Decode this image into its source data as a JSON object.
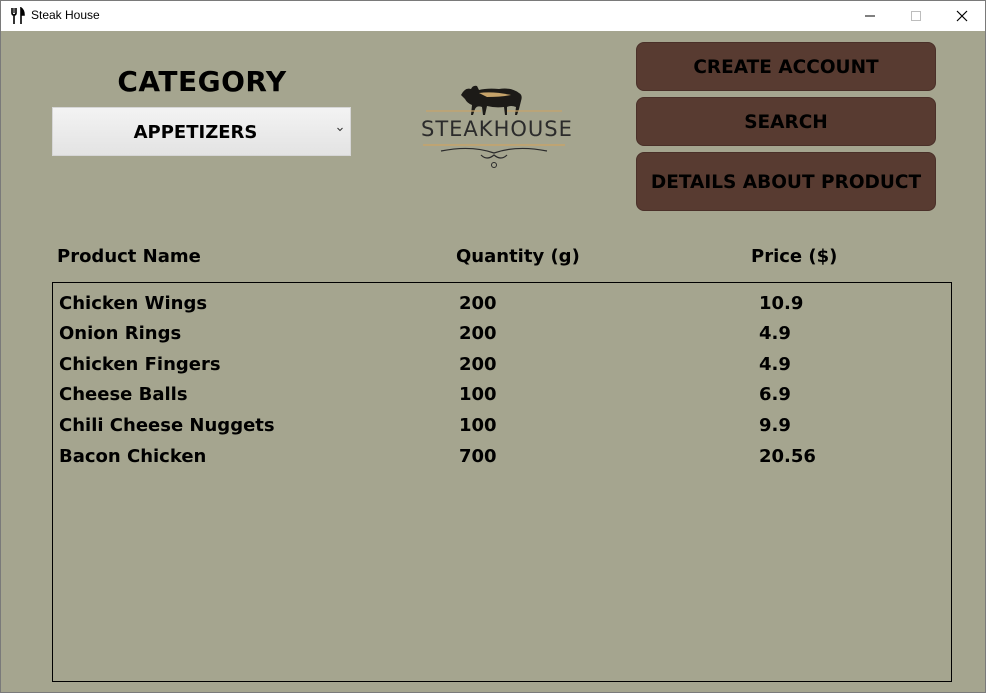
{
  "window": {
    "title": "Steak House",
    "app_icon": "fork-knife-icon"
  },
  "category": {
    "label": "CATEGORY",
    "selected": "APPETIZERS"
  },
  "logo": {
    "text": "STEAKHOUSE"
  },
  "buttons": {
    "create_account": "CREATE ACCOUNT",
    "search": "SEARCH",
    "details": "DETAILS ABOUT PRODUCT"
  },
  "columns": {
    "name": "Product Name",
    "quantity": "Quantity (g)",
    "price": "Price ($)"
  },
  "products": [
    {
      "name": "Chicken Wings",
      "quantity": "200",
      "price": "10.9"
    },
    {
      "name": "Onion Rings",
      "quantity": "200",
      "price": "4.9"
    },
    {
      "name": "Chicken Fingers",
      "quantity": "200",
      "price": "4.9"
    },
    {
      "name": "Cheese Balls",
      "quantity": "100",
      "price": "6.9"
    },
    {
      "name": "Chili Cheese Nuggets",
      "quantity": "100",
      "price": "9.9"
    },
    {
      "name": "Bacon Chicken",
      "quantity": "700",
      "price": "20.56"
    }
  ],
  "colors": {
    "background": "#a5a58f",
    "button": "#583b31"
  }
}
